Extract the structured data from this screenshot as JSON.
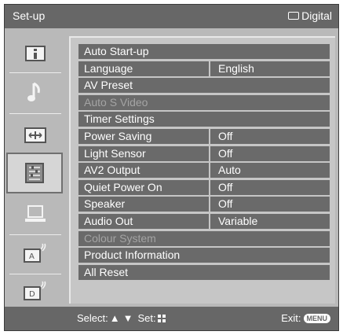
{
  "header": {
    "title": "Set-up",
    "source": "Digital"
  },
  "sidebar": {
    "icons": [
      "picture-icon",
      "sound-icon",
      "screen-icon",
      "setup-icon",
      "pc-icon",
      "analogue-icon",
      "digital-icon"
    ]
  },
  "menu": {
    "rows": [
      {
        "label": "Auto Start-up",
        "value": "",
        "enabled": true
      },
      {
        "label": "Language",
        "value": "English",
        "enabled": true
      },
      {
        "label": "AV Preset",
        "value": "",
        "enabled": true
      },
      {
        "label": "Auto S Video",
        "value": "",
        "enabled": false
      },
      {
        "label": "Timer Settings",
        "value": "",
        "enabled": true
      },
      {
        "label": "Power Saving",
        "value": "Off",
        "enabled": true
      },
      {
        "label": "Light Sensor",
        "value": "Off",
        "enabled": true
      },
      {
        "label": "AV2 Output",
        "value": "Auto",
        "enabled": true
      },
      {
        "label": "Quiet Power On",
        "value": "Off",
        "enabled": true
      },
      {
        "label": "Speaker",
        "value": "Off",
        "enabled": true
      },
      {
        "label": "Audio Out",
        "value": "Variable",
        "enabled": true
      },
      {
        "label": "Colour System",
        "value": "",
        "enabled": false
      },
      {
        "label": "Product Information",
        "value": "",
        "enabled": true
      },
      {
        "label": "All Reset",
        "value": "",
        "enabled": true
      }
    ]
  },
  "footer": {
    "select_label": "Select:",
    "set_label": "Set:",
    "exit_label": "Exit:",
    "menu_badge": "MENU"
  }
}
